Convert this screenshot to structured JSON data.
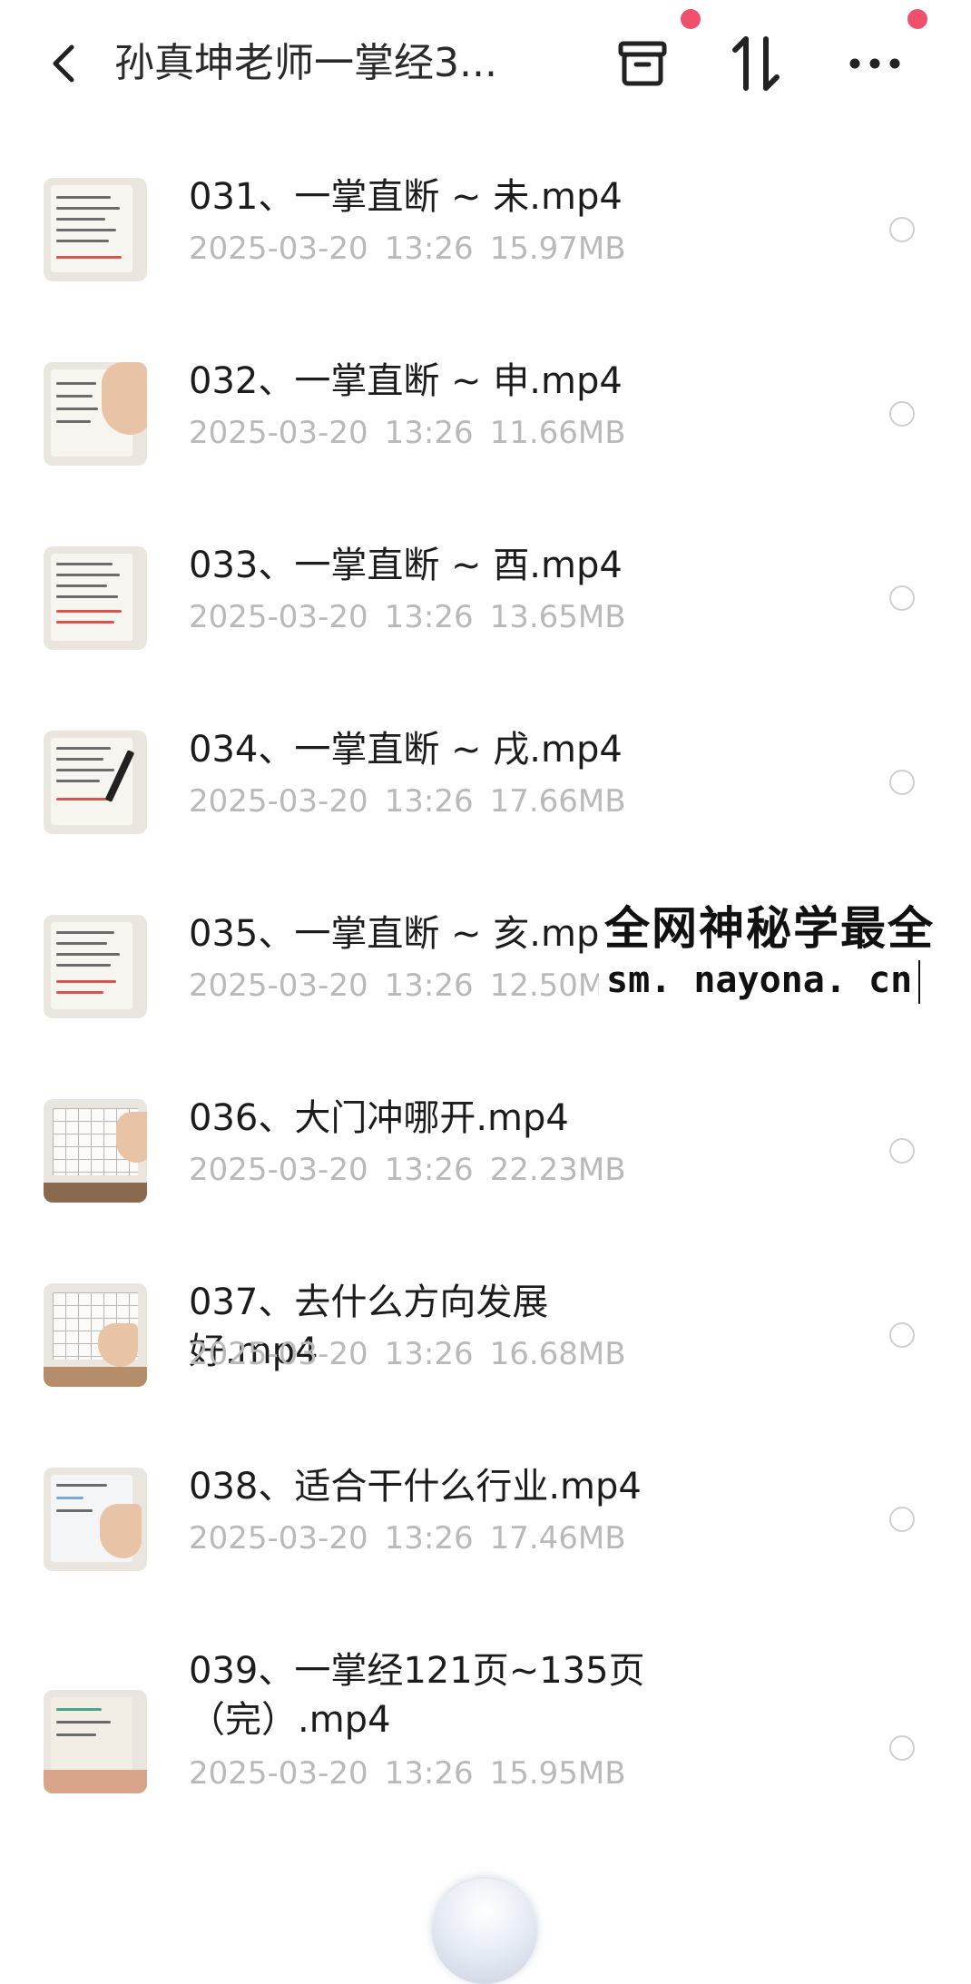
{
  "header": {
    "title": "孙真坤老师一掌经3...",
    "back_icon": "chevron-left-icon",
    "actions": [
      {
        "name": "archive-box-icon"
      },
      {
        "name": "sort-icon"
      },
      {
        "name": "more-icon"
      }
    ],
    "badge_color": "#f0506e"
  },
  "files": [
    {
      "name": "031、一掌直断 ~ 未.mp4",
      "date": "2025-03-20",
      "time": "13:26",
      "size": "15.97MB"
    },
    {
      "name": "032、一掌直断 ~ 申.mp4",
      "date": "2025-03-20",
      "time": "13:26",
      "size": "11.66MB"
    },
    {
      "name": "033、一掌直断 ~ 酉.mp4",
      "date": "2025-03-20",
      "time": "13:26",
      "size": "13.65MB"
    },
    {
      "name": "034、一掌直断 ~ 戌.mp4",
      "date": "2025-03-20",
      "time": "13:26",
      "size": "17.66MB"
    },
    {
      "name": "035、一掌直断 ~ 亥.mp4",
      "date": "2025-03-20",
      "time": "13:26",
      "size": "12.50MB"
    },
    {
      "name": "036、大门冲哪开.mp4",
      "date": "2025-03-20",
      "time": "13:26",
      "size": "22.23MB"
    },
    {
      "name": "037、去什么方向发展好.mp4",
      "date": "2025-03-20",
      "time": "13:26",
      "size": "16.68MB"
    },
    {
      "name": "038、适合干什么行业.mp4",
      "date": "2025-03-20",
      "time": "13:26",
      "size": "17.46MB"
    },
    {
      "name": "039、一掌经121页~135页（完）.mp4",
      "date": "2025-03-20",
      "time": "13:26",
      "size": "15.95MB"
    }
  ],
  "watermark": {
    "line1": "全网神秘学最全",
    "line2": "sm. nayona. cn"
  }
}
